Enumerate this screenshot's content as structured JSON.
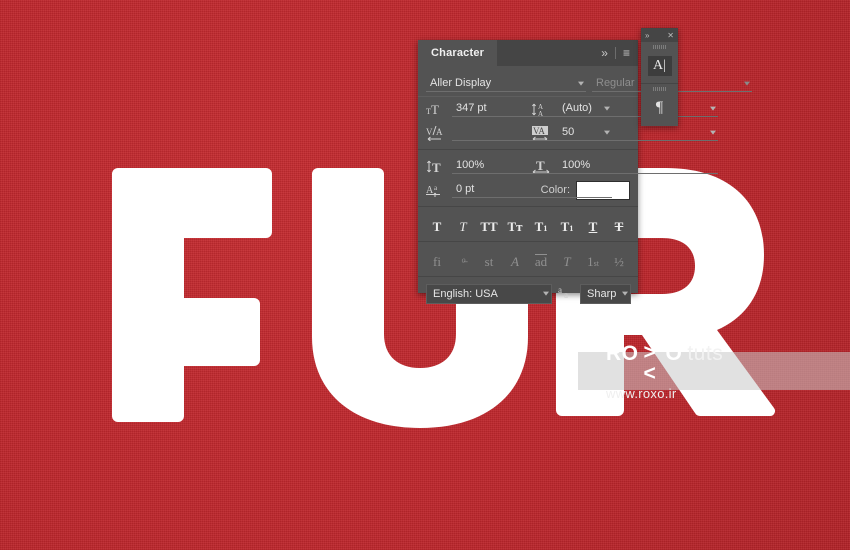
{
  "document": {
    "artwork_text": "FUR",
    "background_color": "#c0282e",
    "text_color": "#ffffff"
  },
  "watermark": {
    "brand_bold": "RO",
    "brand_x": "><",
    "brand_bold2": "O",
    "brand_light": "tuts",
    "url": "www.roxo.ir"
  },
  "panel": {
    "tab_label": "Character",
    "collapse_icon": "»",
    "menu_icon": "≡",
    "font_family": "Aller Display",
    "font_style": "Regular",
    "font_size": "347 pt",
    "leading": "(Auto)",
    "kerning": "",
    "tracking": "50",
    "vertical_scale": "100%",
    "horizontal_scale": "100%",
    "baseline_shift": "0 pt",
    "color_label": "Color:",
    "color_value": "#ffffff",
    "language": "English: USA",
    "antialias": "Sharp",
    "antialias_icon": "aa",
    "icons": {
      "font_size": "T",
      "leading": "A",
      "kerning": "V/A",
      "tracking": "VA",
      "vertical_scale": "T",
      "horizontal_scale": "T",
      "baseline_shift": "Aa"
    },
    "style_buttons": [
      {
        "name": "faux-bold",
        "label": "T"
      },
      {
        "name": "faux-italic",
        "label": "T"
      },
      {
        "name": "all-caps",
        "label": "TT"
      },
      {
        "name": "small-caps",
        "label": "Tт"
      },
      {
        "name": "superscript",
        "label": "T"
      },
      {
        "name": "subscript",
        "label": "T"
      },
      {
        "name": "underline",
        "label": "T"
      },
      {
        "name": "strikethrough",
        "label": "T"
      }
    ],
    "opentype_buttons": [
      {
        "name": "standard-ligatures",
        "label": "fi"
      },
      {
        "name": "contextual-alternates",
        "label": "ᵒ̵"
      },
      {
        "name": "discretionary-ligatures",
        "label": "st"
      },
      {
        "name": "swash",
        "label": "A"
      },
      {
        "name": "oldstyle",
        "label": "ad"
      },
      {
        "name": "titling-alternates",
        "label": "T"
      },
      {
        "name": "ordinals",
        "label": "1st"
      },
      {
        "name": "fractions",
        "label": "½"
      }
    ]
  },
  "dock": {
    "collapse_icon": "»",
    "close_icon": "✕",
    "character_icon": "A",
    "paragraph_icon": "¶"
  }
}
